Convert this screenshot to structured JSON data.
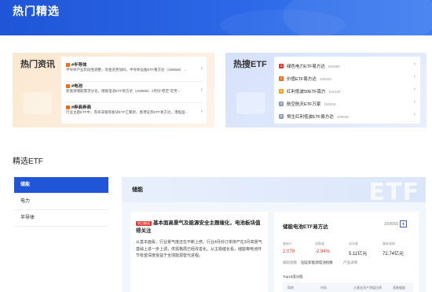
{
  "hero": {
    "title": "热门精选"
  },
  "hot_news": {
    "label": "热门资讯",
    "items": [
      {
        "title": "#半导体",
        "desc": "半导体产业阶段性调整，资金逆势加码，半导体设备ETF看方达（159558）..."
      },
      {
        "title": "#电池",
        "desc": "新能源储能需求分化，储能电池ETF易方达（159566）2月份\"稳定\"走势..."
      },
      {
        "title": "#券商券商",
        "desc": "行业主题ETF中，券商非银等板块ETF汇聚新，香港证券ETF易方达，港股国..."
      }
    ]
  },
  "hot_etf": {
    "label": "热搜ETF",
    "items": [
      {
        "num": "1",
        "name": "绿色电力ETF易方达",
        "code": "562960",
        "color": "#e2362e"
      },
      {
        "num": "2",
        "name": "价值ETF易方达",
        "code": "159263",
        "color": "#ef6a1f"
      },
      {
        "num": "3",
        "name": "红利低波50ETF南方",
        "code": "516150",
        "color": "#f0a21a"
      },
      {
        "num": "4",
        "name": "航空航天ETF万家",
        "code": "159308",
        "color": "#8c9ab8"
      },
      {
        "num": "5",
        "name": "恒生红利低波ETF易方达",
        "code": "159545",
        "color": "#8c9ab8"
      }
    ]
  },
  "section": {
    "title": "精选ETF"
  },
  "tabs": [
    "储能",
    "电力",
    "半导体"
  ],
  "panel": {
    "label": "储能",
    "watermark": "ETF",
    "news": {
      "tag": "热点解读",
      "headline": "基本面高景气及能源安全主题催化，电池板块值得关注",
      "body": "从基本面看，行业景气度还在不断上修。行业4月份订单排产在3月高景气基础上进一步上调，供需格局已经改善化。从主题催化看，储能等电池环节有望深度受益于全球能源替代进程。"
    },
    "fund": {
      "name": "储能电池ETF易方达",
      "code": "159566",
      "add": "+",
      "stats": [
        {
          "label": "最新价",
          "value": "2.079",
          "color": "#e2362e"
        },
        {
          "label": "涨跌幅",
          "value": "-2.94%",
          "color": "#e2362e"
        },
        {
          "label": "成交额",
          "value": "5.11亿元",
          "color": "#222222"
        },
        {
          "label": "最新规模",
          "value": "72.74亿元",
          "color": "#222222"
        }
      ],
      "meta_label": "跟踪指数",
      "meta_value": "国证新能源电池指数",
      "meta_link": "产品详情",
      "top10": "Top10成分股",
      "holdings_cols": [
        "简称",
        "代码",
        "占基金资产净值比例",
        "涨跌幅度"
      ]
    }
  }
}
